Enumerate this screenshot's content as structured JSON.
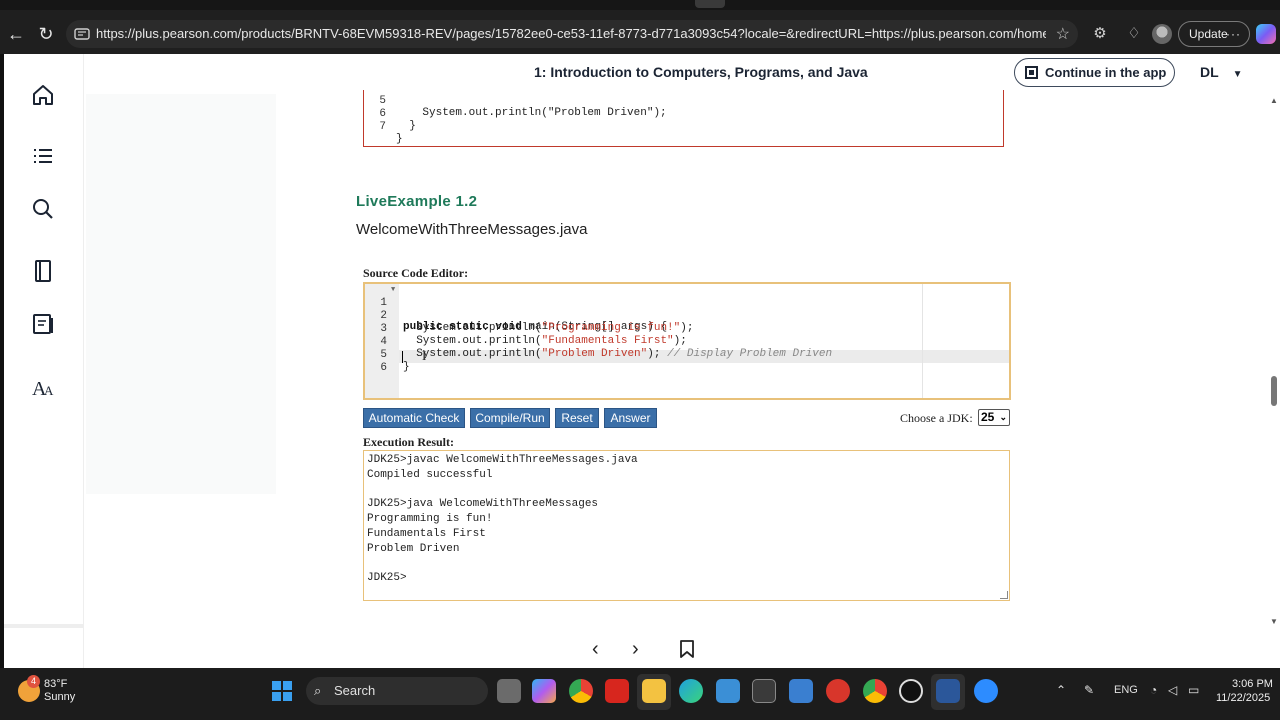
{
  "browser": {
    "url": "https://plus.pearson.com/products/BRNTV-68EVM59318-REV/pages/15782ee0-ce53-11ef-8773-d771a3093c54?locale=&redirectURL=https://plus.pearson.com/home&userPreferredT...",
    "update_label": "Update"
  },
  "header": {
    "chapter_title": "1: Introduction to Computers, Programs, and Java",
    "continue_label": "Continue in the app",
    "user_initials": "DL"
  },
  "prev_code": {
    "lines": [
      {
        "num": "5",
        "text": "    System.out.println(\"Problem Driven\");"
      },
      {
        "num": "6",
        "text": "  }"
      },
      {
        "num": "7",
        "text": "}"
      }
    ]
  },
  "live_example": {
    "heading": "LiveExample 1.2",
    "file_name": "WelcomeWithThreeMessages.java",
    "source_label": "Source Code Editor:",
    "line_numbers": [
      "1",
      "2",
      "3",
      "4",
      "5",
      "6"
    ],
    "code_line1_kw": "public static void",
    "code_line1_rest": " main(String[] args) {",
    "code_line2_pre": "  System.out.println(",
    "code_line2_str": "\"Programming is fun!\"",
    "code_line2_post": ");",
    "code_line3_pre": "  System.out.println(",
    "code_line3_str": "\"Fundamentals First\"",
    "code_line3_post": ");",
    "code_line4_pre": "  System.out.println(",
    "code_line4_str": "\"Problem Driven\"",
    "code_line4_post": "); ",
    "code_line4_cmt": "// Display Problem Driven",
    "code_line5": "}",
    "buttons": {
      "auto_check": "Automatic Check",
      "compile_run": "Compile/Run",
      "reset": "Reset",
      "answer": "Answer"
    },
    "jdk_label": "Choose a JDK:",
    "jdk_value": "25",
    "exec_label": "Execution Result:",
    "exec_lines": [
      "JDK25>javac WelcomeWithThreeMessages.java",
      "Compiled successful",
      "",
      "JDK25>java WelcomeWithThreeMessages",
      "Programming is fun!",
      "Fundamentals First",
      "Problem Driven",
      "",
      "JDK25>"
    ]
  },
  "taskbar": {
    "weather_badge": "4",
    "weather_temp": "83°F",
    "weather_cond": "Sunny",
    "search_label": "Search",
    "lang": "ENG",
    "time": "3:06 PM",
    "date": "11/22/2025"
  },
  "colors": {
    "heading_green": "#1f7a5a",
    "button_blue": "#3b6fa8",
    "editor_border": "#e8c17a",
    "code_string": "#c0392b"
  }
}
